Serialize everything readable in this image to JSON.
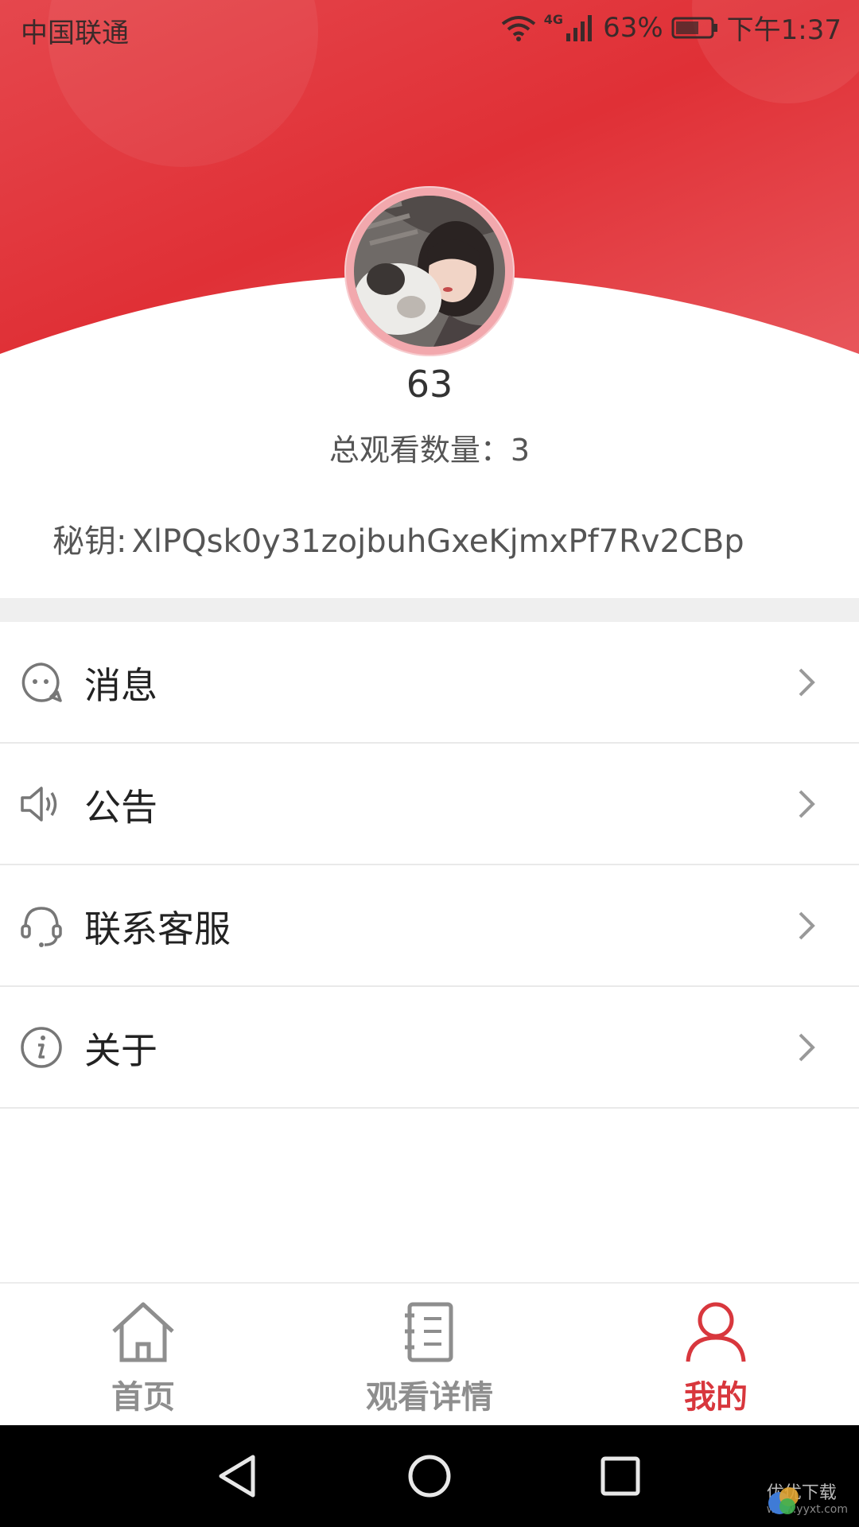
{
  "status_bar": {
    "carrier": "中国联通",
    "network": "4G",
    "battery": "63%",
    "time": "下午1:37"
  },
  "profile": {
    "username": "63",
    "watch_count_label": "总观看数量：",
    "watch_count_value": "3",
    "secret_label": "秘钥:",
    "secret_value": "XlPQsk0y31zojbuhGxeKjmxPf7Rv2CBp"
  },
  "menu": {
    "items": [
      {
        "label": "消息",
        "icon": "message-icon"
      },
      {
        "label": "公告",
        "icon": "speaker-icon"
      },
      {
        "label": "联系客服",
        "icon": "headset-icon"
      },
      {
        "label": "关于",
        "icon": "info-icon"
      }
    ]
  },
  "tabs": [
    {
      "label": "首页",
      "icon": "home-icon",
      "active": false
    },
    {
      "label": "观看详情",
      "icon": "notebook-icon",
      "active": false
    },
    {
      "label": "我的",
      "icon": "user-icon",
      "active": true
    }
  ],
  "watermark": {
    "text": "优优下载",
    "url": "www.yyxt.com"
  },
  "colors": {
    "accent": "#d8373d",
    "header_red": "#e23b41",
    "inactive_tab": "#8e8e8e"
  }
}
